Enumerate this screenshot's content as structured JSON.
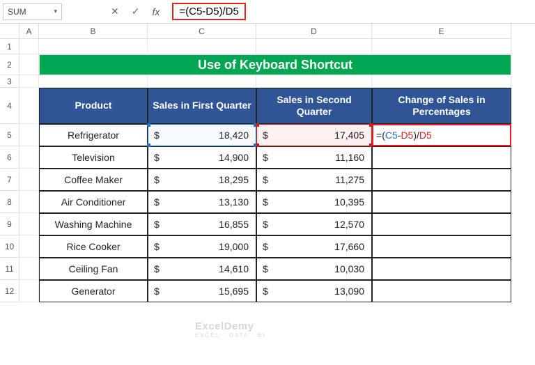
{
  "nameBox": "SUM",
  "formulaBar": {
    "cancelIcon": "✕",
    "enterIcon": "✓",
    "fxLabel": "fx",
    "formulaDisplay": "=(C5-D5)/D5"
  },
  "columns": [
    "A",
    "B",
    "C",
    "D",
    "E"
  ],
  "rows": [
    "1",
    "2",
    "3",
    "4",
    "5",
    "6",
    "7",
    "8",
    "9",
    "10",
    "11",
    "12"
  ],
  "title": "Use of  Keyboard Shortcut",
  "headers": {
    "product": "Product",
    "q1": "Sales in First Quarter",
    "q2": "Sales in Second Quarter",
    "change": "Change of Sales in Percentages"
  },
  "editing": {
    "eq": "=",
    "lp": "(",
    "c5": "C5",
    "minus": "-",
    "d5a": "D5",
    "rp": ")",
    "slash": "/",
    "d5b": "D5"
  },
  "chart_data": {
    "type": "table",
    "title": "Use of Keyboard Shortcut",
    "columns": [
      "Product",
      "Sales in First Quarter",
      "Sales in Second Quarter",
      "Change of Sales in Percentages"
    ],
    "rows": [
      {
        "product": "Refrigerator",
        "q1": 18420,
        "q2": 17405,
        "change": null
      },
      {
        "product": "Television",
        "q1": 14900,
        "q2": 11160,
        "change": null
      },
      {
        "product": "Coffee Maker",
        "q1": 18295,
        "q2": 11275,
        "change": null
      },
      {
        "product": "Air Conditioner",
        "q1": 13130,
        "q2": 10395,
        "change": null
      },
      {
        "product": "Washing Machine",
        "q1": 16855,
        "q2": 12570,
        "change": null
      },
      {
        "product": "Rice Cooker",
        "q1": 19000,
        "q2": 17660,
        "change": null
      },
      {
        "product": "Ceiling Fan",
        "q1": 14610,
        "q2": 10030,
        "change": null
      },
      {
        "product": "Generator",
        "q1": 15695,
        "q2": 13090,
        "change": null
      }
    ],
    "display": [
      {
        "product": "Refrigerator",
        "q1": "18,420",
        "q2": "17,405"
      },
      {
        "product": "Television",
        "q1": "14,900",
        "q2": "11,160"
      },
      {
        "product": "Coffee Maker",
        "q1": "18,295",
        "q2": "11,275"
      },
      {
        "product": "Air Conditioner",
        "q1": "13,130",
        "q2": "10,395"
      },
      {
        "product": "Washing Machine",
        "q1": "16,855",
        "q2": "12,570"
      },
      {
        "product": "Rice Cooker",
        "q1": "19,000",
        "q2": "17,660"
      },
      {
        "product": "Ceiling Fan",
        "q1": "14,610",
        "q2": "10,030"
      },
      {
        "product": "Generator",
        "q1": "15,695",
        "q2": "13,090"
      }
    ]
  },
  "currency": "$",
  "watermark": {
    "main": "ExcelDemy",
    "sub": "EXCEL · DATA · BI"
  }
}
